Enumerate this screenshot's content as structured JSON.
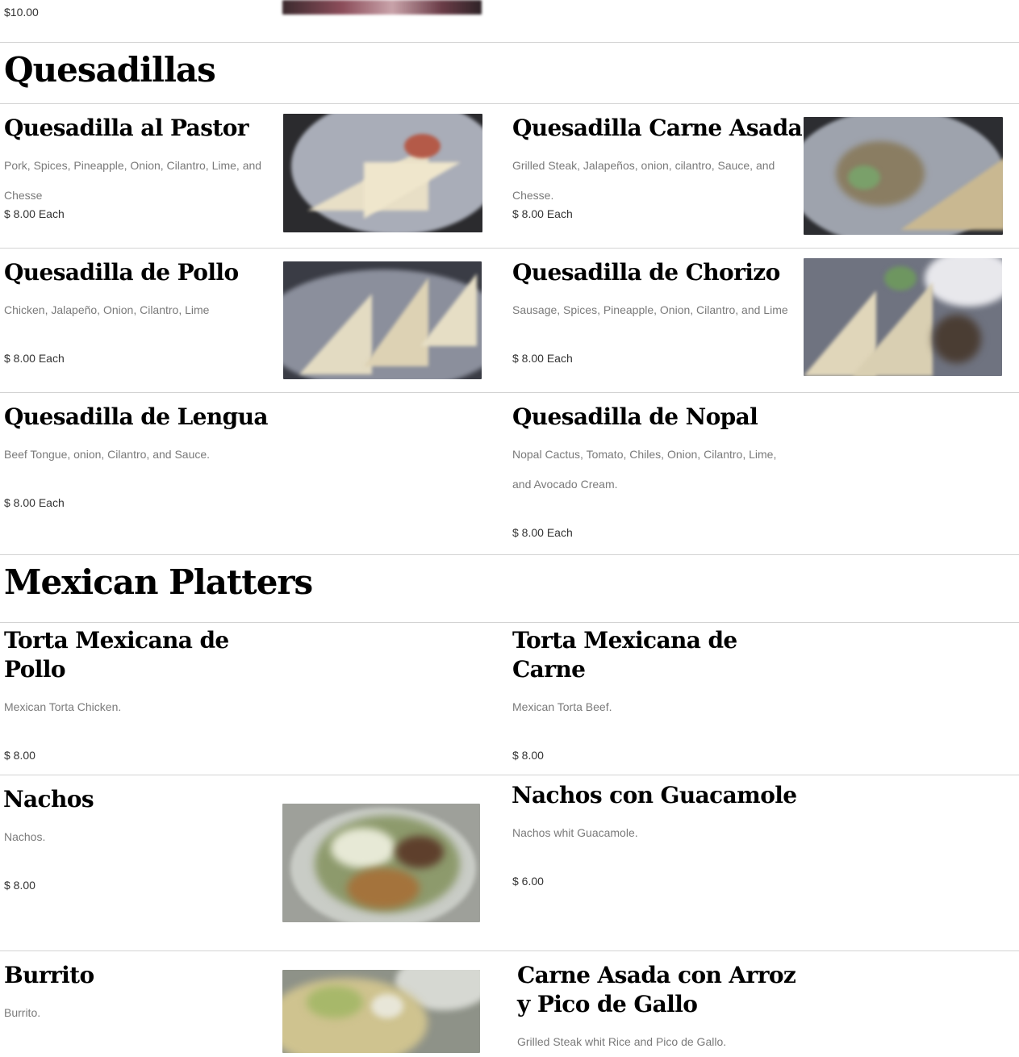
{
  "top_item": {
    "price": "$10.00"
  },
  "sections": {
    "quesadillas": {
      "title": "Quesadillas",
      "items": [
        {
          "title": "Quesadilla al Pastor",
          "description": "Pork, Spices, Pineapple, Onion, Cilantro, Lime, and Chesse",
          "price": "$ 8.00 Each",
          "image": "quesadilla-plate-photo"
        },
        {
          "title": "Quesadilla Carne Asada",
          "description": "Grilled Steak, Jalapeños, onion, cilantro, Sauce, and Chesse.",
          "price": "$ 8.00 Each",
          "image": "quesadilla-plate-photo"
        },
        {
          "title": "Quesadilla de Pollo",
          "description": "Chicken, Jalapeño, Onion, Cilantro, Lime",
          "price": "$ 8.00 Each",
          "image": "quesadilla-slices-photo"
        },
        {
          "title": "Quesadilla de Chorizo",
          "description": "Sausage, Spices, Pineapple, Onion, Cilantro, and Lime",
          "price": "$ 8.00 Each",
          "image": "quesadilla-slices-photo"
        },
        {
          "title": "Quesadilla de Lengua",
          "description": "Beef Tongue, onion, Cilantro, and Sauce.",
          "price": "$ 8.00 Each"
        },
        {
          "title": "Quesadilla de Nopal",
          "description": "Nopal Cactus, Tomato, Chiles, Onion, Cilantro, Lime, and Avocado Cream.",
          "price": "$ 8.00 Each"
        }
      ]
    },
    "platters": {
      "title": "Mexican Platters",
      "items": [
        {
          "title": "Torta Mexicana de Pollo",
          "description": "Mexican Torta Chicken.",
          "price": "$ 8.00"
        },
        {
          "title": "Torta Mexicana de Carne",
          "description": "Mexican Torta Beef.",
          "price": "$ 8.00"
        },
        {
          "title": "Nachos",
          "description": "Nachos.",
          "price": "$ 8.00",
          "image": "nachos-photo"
        },
        {
          "title": "Nachos con Guacamole",
          "description": "Nachos whit Guacamole.",
          "price": "$ 6.00"
        },
        {
          "title": "Burrito",
          "description": "Burrito.",
          "image": "burrito-photo"
        },
        {
          "title": "Carne Asada con Arroz y Pico de Gallo",
          "description": "Grilled Steak whit Rice and Pico de Gallo."
        }
      ]
    }
  },
  "colors": {
    "divider": "#d3d3d3",
    "description_text": "#7a7a7a",
    "title_text": "#000000"
  }
}
